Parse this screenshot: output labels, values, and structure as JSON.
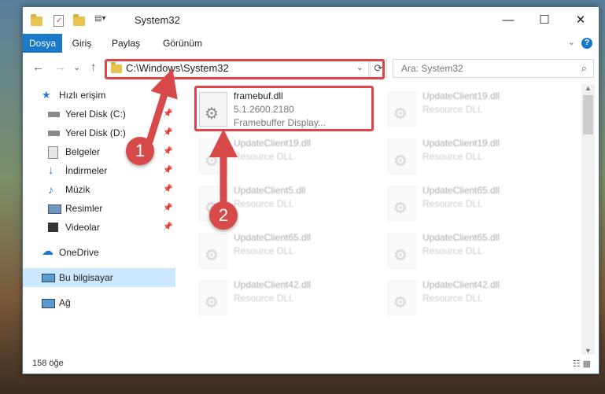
{
  "window": {
    "title": "System32",
    "controls": {
      "minimize": "—",
      "maximize": "☐",
      "close": "✕"
    }
  },
  "ribbon": {
    "tabs": [
      "Dosya",
      "Giriş",
      "Paylaş",
      "Görünüm"
    ],
    "help": "?"
  },
  "nav": {
    "back": "←",
    "forward": "→",
    "dropdown": "⌄",
    "up": "↑",
    "path": "C:\\Windows\\System32",
    "refresh": "⟳",
    "search_placeholder": "Ara: System32"
  },
  "sidebar": {
    "items": [
      {
        "label": "Hızlı erişim",
        "icon": "star-icon",
        "pinned": false
      },
      {
        "label": "Yerel Disk (C:)",
        "icon": "drive-icon",
        "pinned": true
      },
      {
        "label": "Yerel Disk (D:)",
        "icon": "drive-icon",
        "pinned": true
      },
      {
        "label": "Belgeler",
        "icon": "documents-icon",
        "pinned": true
      },
      {
        "label": "İndirmeler",
        "icon": "download-icon",
        "pinned": true
      },
      {
        "label": "Müzik",
        "icon": "music-icon",
        "pinned": true
      },
      {
        "label": "Resimler",
        "icon": "pictures-icon",
        "pinned": true
      },
      {
        "label": "Videolar",
        "icon": "videos-icon",
        "pinned": true
      },
      {
        "label": "OneDrive",
        "icon": "cloud-icon",
        "pinned": false
      },
      {
        "label": "Bu bilgisayar",
        "icon": "computer-icon",
        "pinned": false,
        "selected": true
      },
      {
        "label": "Ağ",
        "icon": "network-icon",
        "pinned": false
      }
    ]
  },
  "files": [
    {
      "name": "framebuf.dll",
      "line1": "5.1.2600.2180",
      "line2": "Framebuffer Display..."
    },
    {
      "name": "UpdateClient19.dll",
      "line1": "Resource DLL"
    },
    {
      "name": "UpdateClient19.dll",
      "line1": "Resource DLL"
    },
    {
      "name": "UpdateClient19.dll",
      "line1": "Resource DLL"
    },
    {
      "name": "UpdateClient5.dll",
      "line1": "Resource DLL"
    },
    {
      "name": "UpdateClient65.dll",
      "line1": "Resource DLL"
    },
    {
      "name": "UpdateClient65.dll",
      "line1": "Resource DLL"
    },
    {
      "name": "UpdateClient65.dll",
      "line1": "Resource DLL"
    },
    {
      "name": "UpdateClient42.dll",
      "line1": "Resource DLL"
    },
    {
      "name": "UpdateClient42.dll",
      "line1": "Resource DLL"
    }
  ],
  "status": {
    "count": "158 öğe"
  },
  "callouts": {
    "one": "1",
    "two": "2"
  },
  "colors": {
    "accent": "#1979ca",
    "highlight": "#e0444a",
    "selection": "#cce8ff"
  }
}
